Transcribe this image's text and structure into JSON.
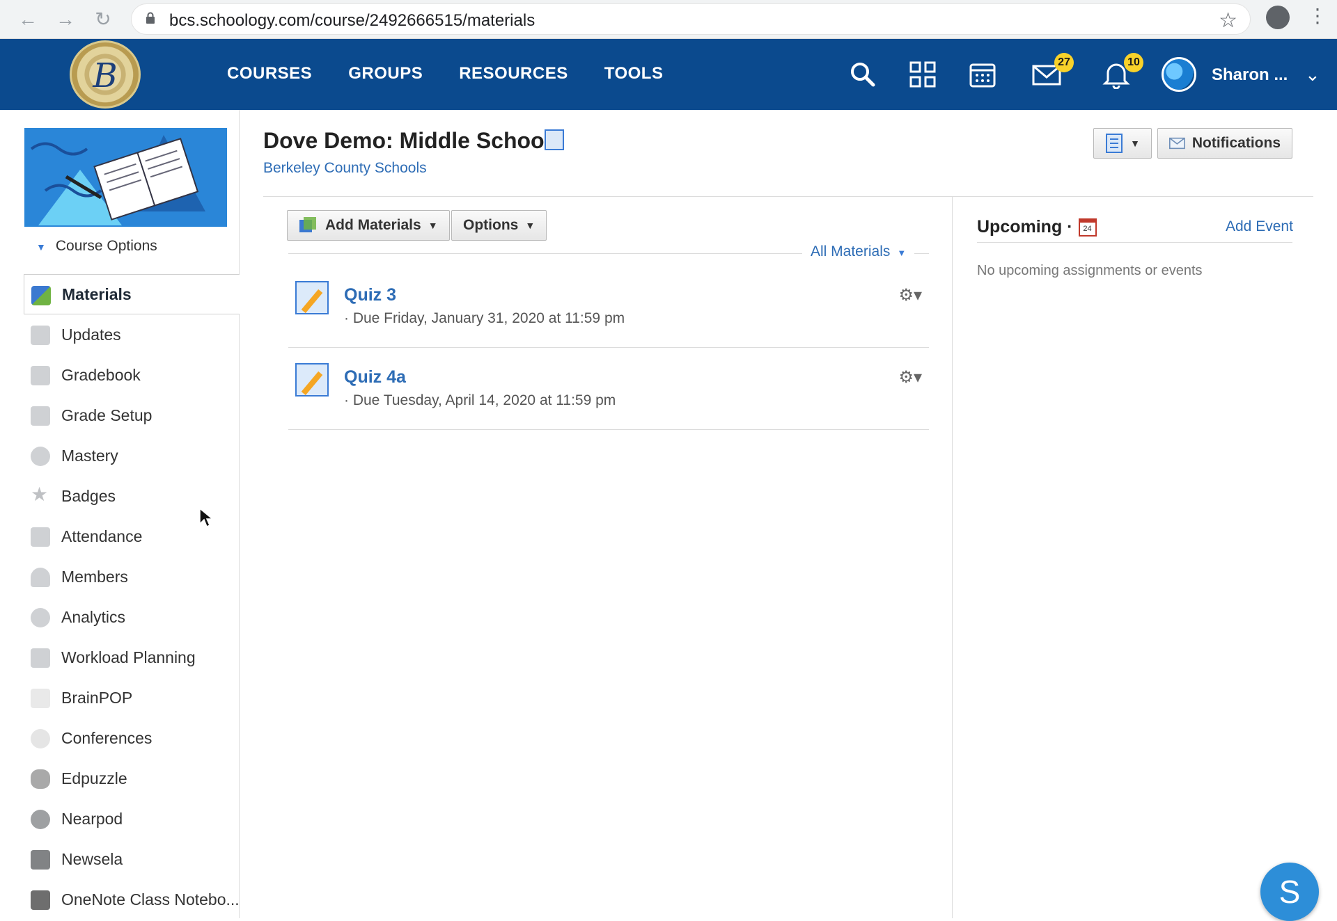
{
  "browser": {
    "url": "bcs.schoology.com/course/2492666515/materials"
  },
  "topnav": {
    "logo_letter": "B",
    "links": [
      "COURSES",
      "GROUPS",
      "RESOURCES",
      "TOOLS"
    ],
    "messages_count": "27",
    "notifications_count": "10",
    "user_name": "Sharon ..."
  },
  "sidebar": {
    "course_options": "Course Options",
    "items": [
      {
        "label": "Materials",
        "icon": "materials-icon"
      },
      {
        "label": "Updates",
        "icon": "updates-icon"
      },
      {
        "label": "Gradebook",
        "icon": "gradebook-icon"
      },
      {
        "label": "Grade Setup",
        "icon": "grade-setup-icon"
      },
      {
        "label": "Mastery",
        "icon": "mastery-icon"
      },
      {
        "label": "Badges",
        "icon": "badges-icon"
      },
      {
        "label": "Attendance",
        "icon": "attendance-icon"
      },
      {
        "label": "Members",
        "icon": "members-icon"
      },
      {
        "label": "Analytics",
        "icon": "analytics-icon"
      },
      {
        "label": "Workload Planning",
        "icon": "workload-icon"
      },
      {
        "label": "BrainPOP",
        "icon": "brainpop-icon"
      },
      {
        "label": "Conferences",
        "icon": "conferences-icon"
      },
      {
        "label": "Edpuzzle",
        "icon": "edpuzzle-icon"
      },
      {
        "label": "Nearpod",
        "icon": "nearpod-icon"
      },
      {
        "label": "Newsela",
        "icon": "newsela-icon"
      },
      {
        "label": "OneNote Class Notebo...",
        "icon": "onenote-icon"
      }
    ]
  },
  "main": {
    "course_title": "Dove Demo: Middle School",
    "school": "Berkeley County Schools",
    "notifications_button": "Notifications",
    "add_materials": "Add Materials",
    "options": "Options",
    "filter": "All Materials",
    "materials": [
      {
        "title": "Quiz 3",
        "due": "· Due Friday, January 31, 2020 at 11:59 pm"
      },
      {
        "title": "Quiz 4a",
        "due": "· Due Tuesday, April 14, 2020 at 11:59 pm"
      }
    ]
  },
  "upcoming": {
    "title": "Upcoming ·",
    "calendar_day": "24",
    "add_event": "Add Event",
    "empty": "No upcoming assignments or events"
  },
  "chat": {
    "letter": "S"
  }
}
